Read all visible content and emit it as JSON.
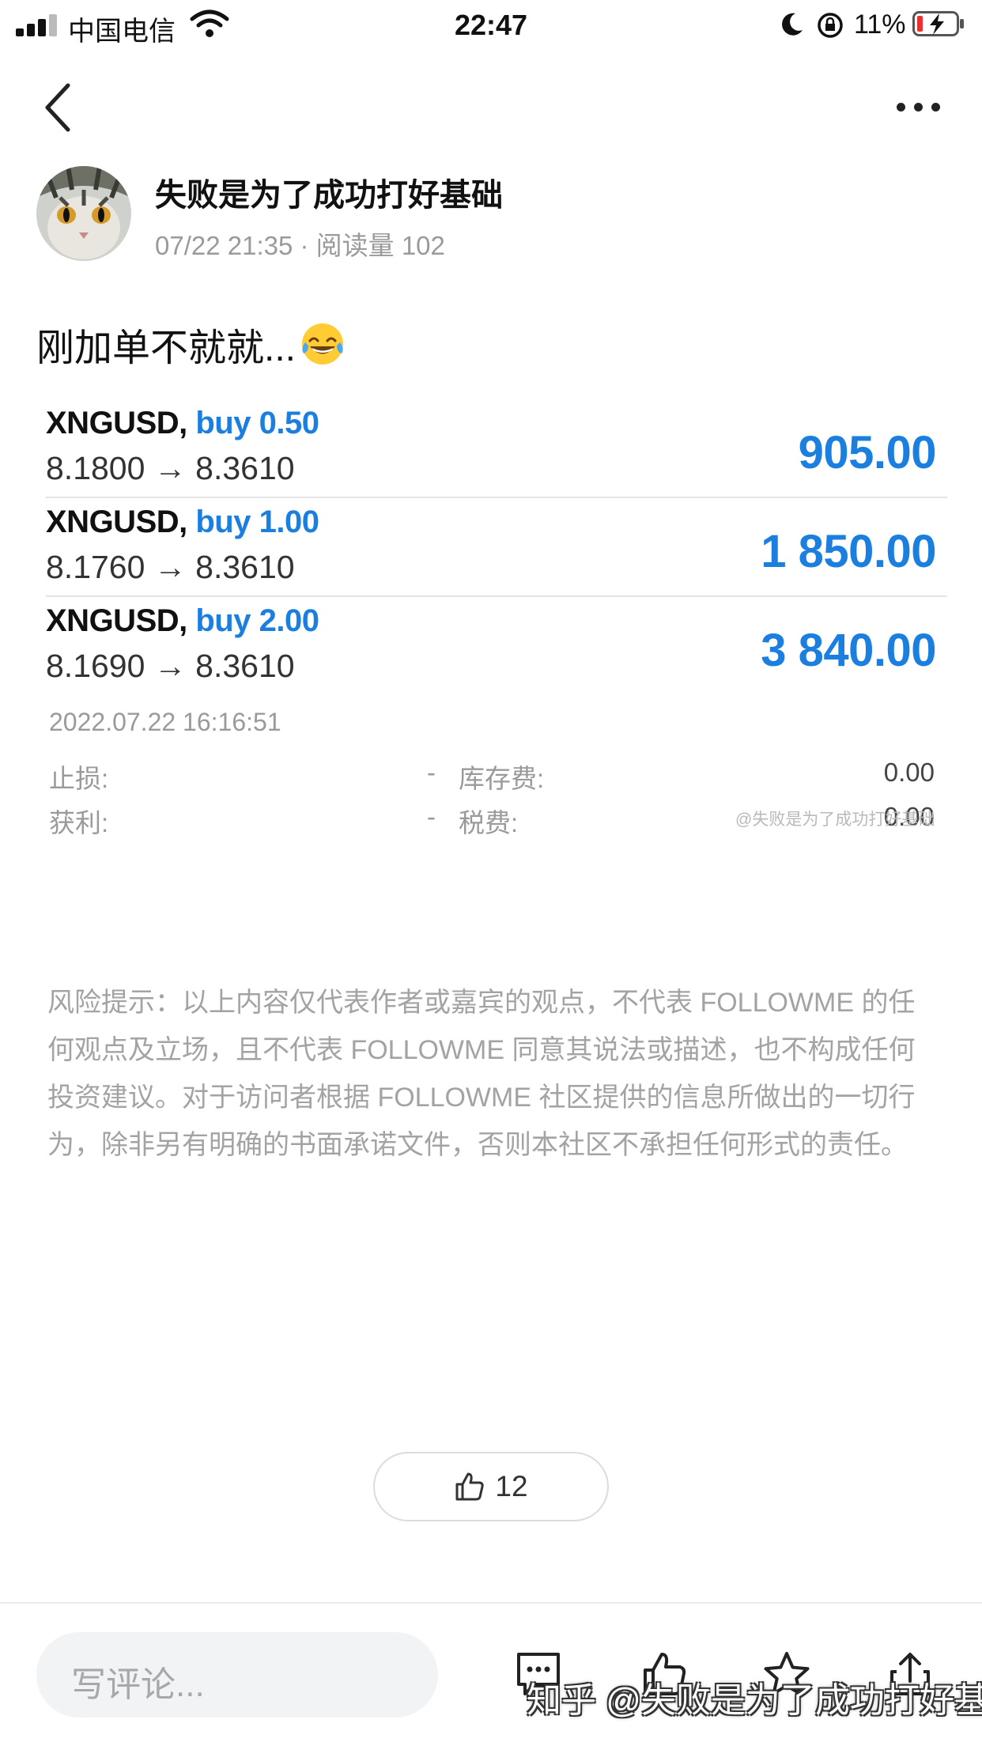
{
  "status_bar": {
    "carrier": "中国电信",
    "time": "22:47",
    "battery_percent": "11%"
  },
  "post": {
    "author": "失败是为了成功打好基础",
    "meta": "07/22 21:35 · 阅读量 102",
    "title": "刚加单不就就...",
    "title_emoji": "tears-of-joy-emoji"
  },
  "trades": [
    {
      "symbol": "XNGUSD,",
      "side": "buy 0.50",
      "prices": "8.1800 → 8.3610",
      "profit": "905.00"
    },
    {
      "symbol": "XNGUSD,",
      "side": "buy 1.00",
      "prices": "8.1760 → 8.3610",
      "profit": "1 850.00"
    },
    {
      "symbol": "XNGUSD,",
      "side": "buy 2.00",
      "prices": "8.1690 → 8.3610",
      "profit": "3 840.00"
    }
  ],
  "trade_time": "2022.07.22 16:16:51",
  "fees": {
    "stop_loss_label": "止损:",
    "stop_loss_value": "-",
    "swap_label": "库存费:",
    "swap_value": "0.00",
    "take_profit_label": "获利:",
    "take_profit_value": "-",
    "tax_label": "税费:",
    "tax_value": "0.00"
  },
  "watermark_small": "@失败是为了成功打好基础",
  "disclaimer": "风险提示：以上内容仅代表作者或嘉宾的观点，不代表 FOLLOWME 的任何观点及立场，且不代表 FOLLOWME 同意其说法或描述，也不构成任何投资建议。对于访问者根据 FOLLOWME 社区提供的信息所做出的一切行为，除非另有明确的书面承诺文件，否则本社区不承担任何形式的责任。",
  "like_count": "12",
  "comment_placeholder": "写评论...",
  "watermark_big": "知乎 @失败是为了成功打好基础",
  "colors": {
    "accent": "#1b7fe0",
    "muted_text": "#9a9a9a"
  }
}
